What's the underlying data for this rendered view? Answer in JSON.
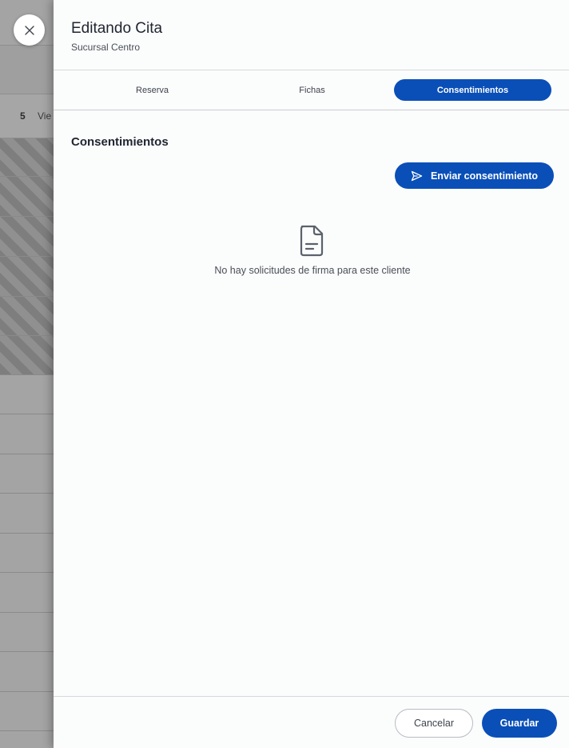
{
  "background": {
    "day_number": "5",
    "day_name": "Vie"
  },
  "header": {
    "title": "Editando Cita",
    "subtitle": "Sucursal Centro",
    "close_icon": "close-icon"
  },
  "tabs": [
    {
      "label": "Reserva",
      "active": false
    },
    {
      "label": "Fichas",
      "active": false
    },
    {
      "label": "Consentimientos",
      "active": true
    }
  ],
  "content": {
    "section_title": "Consentimientos",
    "send_button_label": "Enviar consentimiento",
    "send_icon": "send-icon",
    "empty_icon": "document-icon",
    "empty_message": "No hay solicitudes de firma para este cliente"
  },
  "footer": {
    "cancel_label": "Cancelar",
    "save_label": "Guardar"
  },
  "colors": {
    "primary": "#0a4fb8",
    "overlay": "#a4a4a4",
    "drawer_bg": "#fbfcfc"
  }
}
